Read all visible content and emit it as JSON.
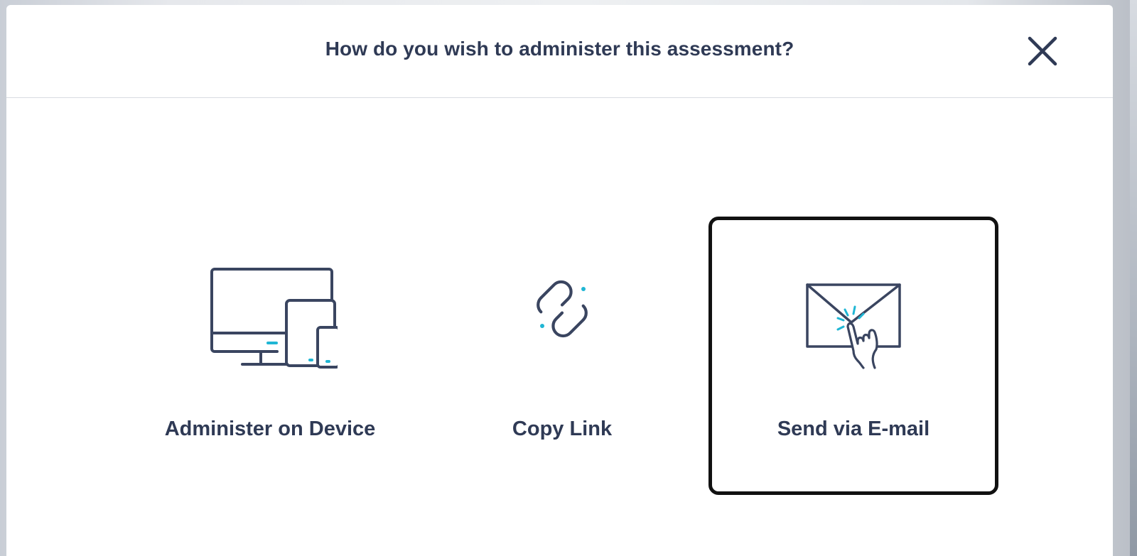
{
  "dialog": {
    "title": "How do you wish to administer this assessment?",
    "close_icon": "close-icon"
  },
  "options": [
    {
      "label": "Administer on Device",
      "icon": "devices-icon",
      "selected": false
    },
    {
      "label": "Copy Link",
      "icon": "link-icon",
      "selected": false
    },
    {
      "label": "Send via E-mail",
      "icon": "email-icon",
      "selected": true
    }
  ],
  "colors": {
    "text": "#2f3a55",
    "icon_stroke": "#3a4560",
    "accent": "#1fb6d4",
    "selected_border": "#111111"
  }
}
